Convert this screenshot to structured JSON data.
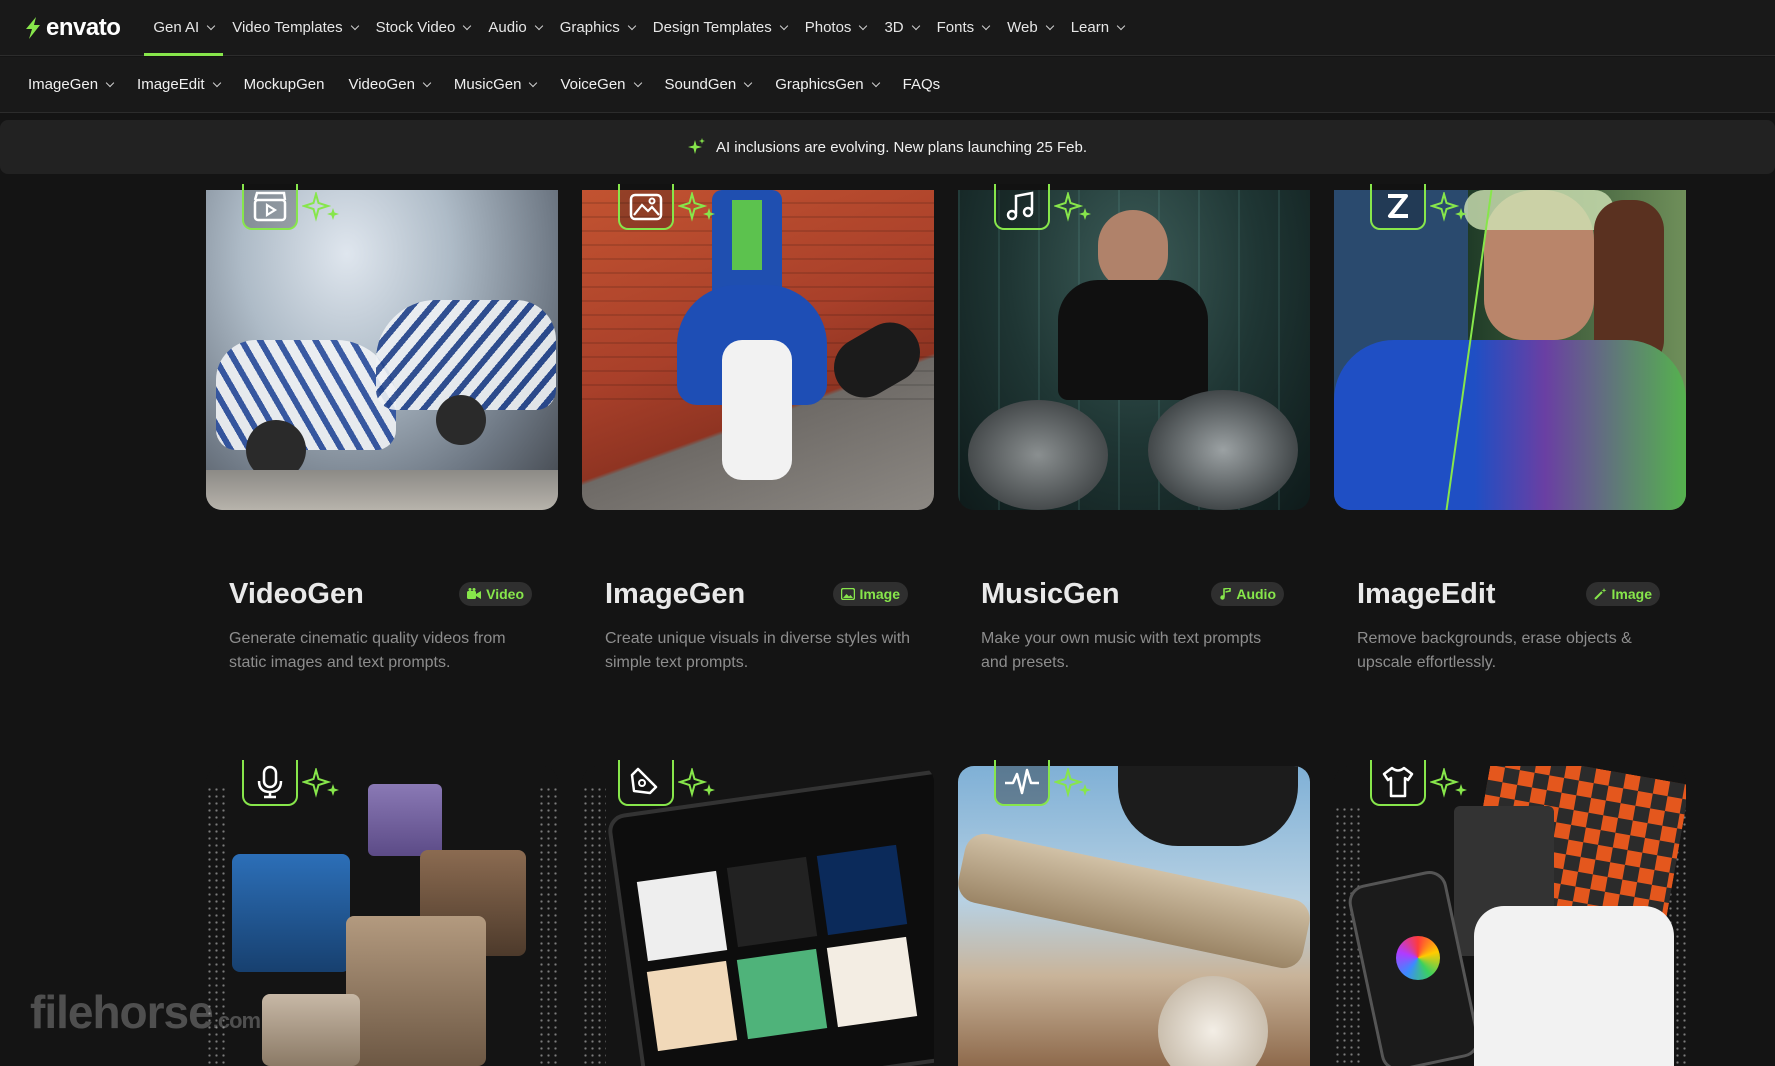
{
  "brand": {
    "name": "envato",
    "accent": "#87e64b"
  },
  "topnav": {
    "items": [
      {
        "label": "Gen AI",
        "active": true
      },
      {
        "label": "Video Templates"
      },
      {
        "label": "Stock Video"
      },
      {
        "label": "Audio"
      },
      {
        "label": "Graphics"
      },
      {
        "label": "Design Templates"
      },
      {
        "label": "Photos"
      },
      {
        "label": "3D"
      },
      {
        "label": "Fonts"
      },
      {
        "label": "Web"
      },
      {
        "label": "Learn"
      }
    ]
  },
  "subnav": {
    "items": [
      {
        "label": "ImageGen"
      },
      {
        "label": "ImageEdit"
      },
      {
        "label": "MockupGen"
      },
      {
        "label": "VideoGen"
      },
      {
        "label": "MusicGen"
      },
      {
        "label": "VoiceGen"
      },
      {
        "label": "SoundGen"
      },
      {
        "label": "GraphicsGen"
      },
      {
        "label": "FAQs"
      }
    ]
  },
  "banner": {
    "text": "AI inclusions are evolving. New plans launching 25 Feb."
  },
  "cards": [
    {
      "title": "VideoGen",
      "badge": "Video",
      "icon": "video-clapper-icon",
      "desc": "Generate cinematic quality videos from static images and text prompts."
    },
    {
      "title": "ImageGen",
      "badge": "Image",
      "icon": "image-icon",
      "desc": "Create unique visuals in diverse styles with simple text prompts."
    },
    {
      "title": "MusicGen",
      "badge": "Audio",
      "icon": "music-note-icon",
      "desc": "Make your own music with text prompts and presets."
    },
    {
      "title": "ImageEdit",
      "badge": "Image",
      "icon": "magic-wand-icon",
      "desc": "Remove backgrounds, erase objects & upscale effortlessly."
    }
  ],
  "row2": [
    {
      "icon": "microphone-icon",
      "image": "voicegen-people-collage"
    },
    {
      "icon": "pen-tool-icon",
      "image": "graphicsgen-tablet"
    },
    {
      "icon": "waveform-icon",
      "image": "soundgen-skateboard"
    },
    {
      "icon": "tshirt-icon",
      "image": "mockupgen-merch"
    }
  ],
  "watermark": {
    "text": "filehorse",
    "suffix": ".com"
  }
}
